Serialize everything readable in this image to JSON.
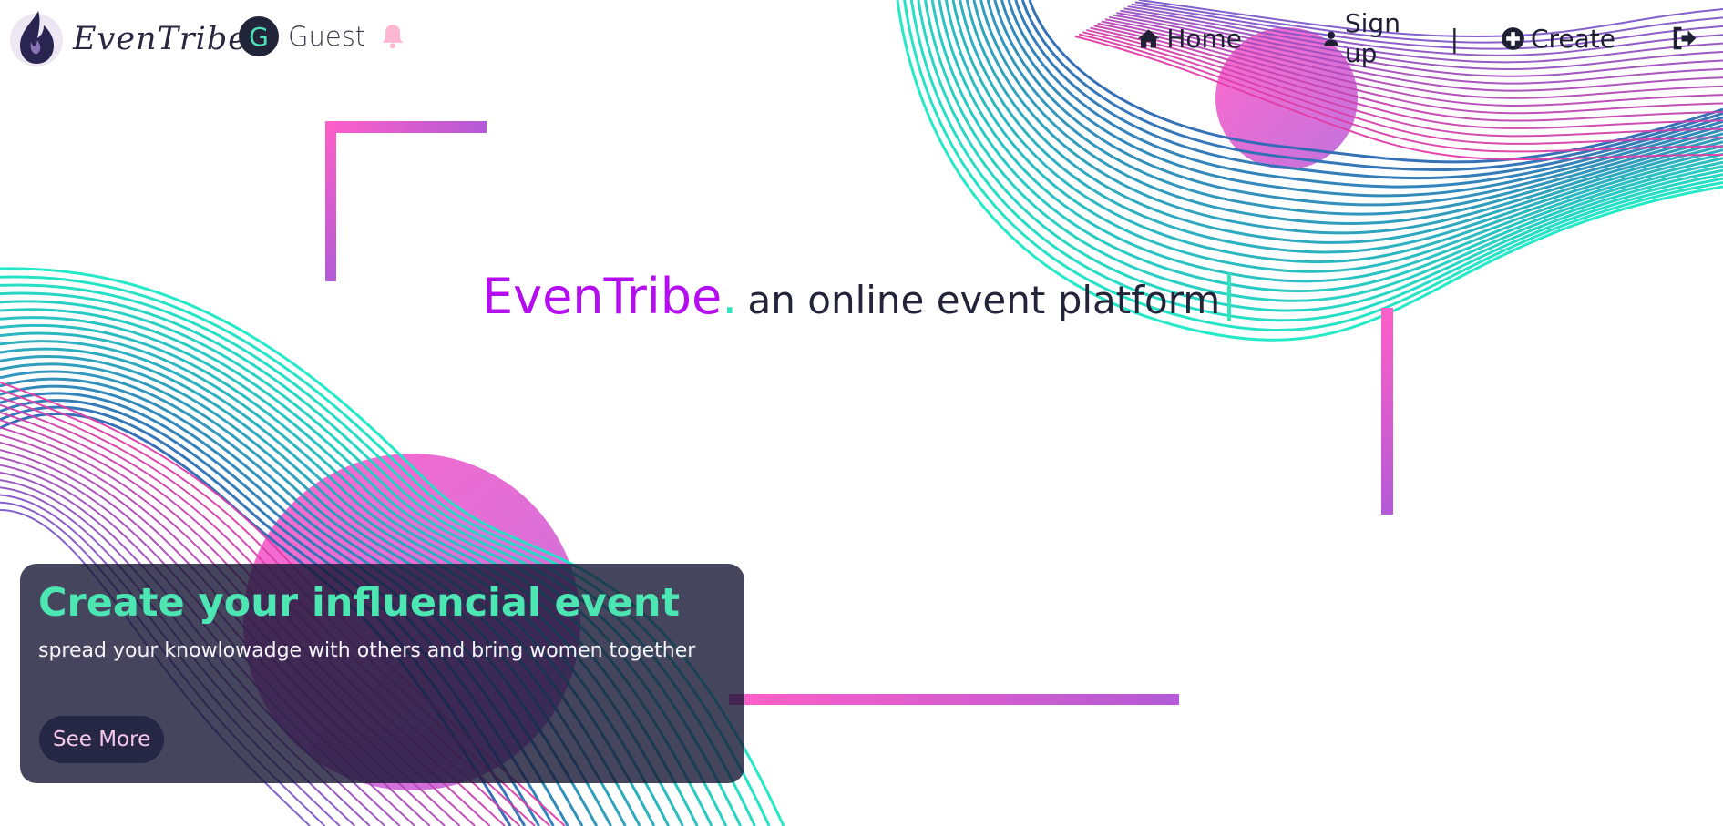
{
  "header": {
    "brand_name": "EvenTribe",
    "user": {
      "initial": "G",
      "name": "Guest"
    },
    "nav": {
      "home": "Home",
      "signup": "Sign up",
      "separator": "|",
      "create": "Create"
    },
    "icons": [
      "logo-icon",
      "bell-icon",
      "home-icon",
      "user-icon",
      "plus-circle-icon",
      "logout-icon"
    ]
  },
  "hero": {
    "brand_word": "EvenTribe",
    "dot": ".",
    "tagline": "an online event platform"
  },
  "card": {
    "title": "Create your influencial event",
    "text": "spread your knowlowadge with others and bring women together",
    "button": "See More"
  },
  "colors": {
    "brand_purple": "#b40ef0",
    "accent_teal": "#30e5bb",
    "accent_pink": "#ff5fc8",
    "accent_violet": "#b35ad6",
    "dark": "#1f2034"
  }
}
